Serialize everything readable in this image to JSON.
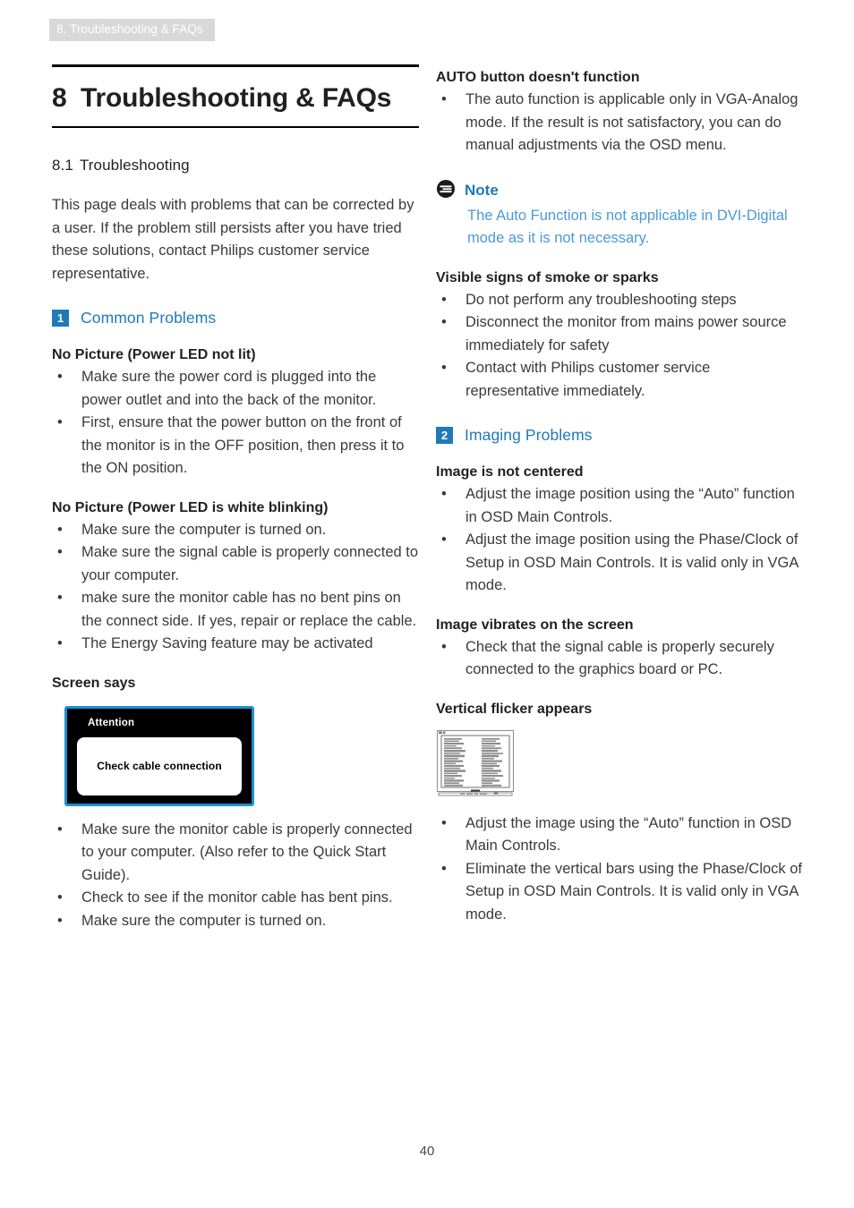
{
  "running_header": "8. Troubleshooting & FAQs",
  "chapter": {
    "number": "8",
    "title": "Troubleshooting & FAQs"
  },
  "section": {
    "number": "8.1",
    "title": "Troubleshooting"
  },
  "colors": {
    "accent_blue": "#1f7ab8",
    "note_body_blue": "#4a9ad4",
    "header_band_gray": "#d8d8d8",
    "osd_border_blue": "#1b8fd4"
  },
  "intro_paragraph": "This page deals with problems that can be corrected by a user. If the problem still persists after you have tried these solutions, contact Philips customer service representative.",
  "left_column": {
    "group_badge": "1",
    "group_title": "Common Problems",
    "blocks": [
      {
        "heading": "No Picture (Power LED not lit)",
        "bullets": [
          "Make sure the power cord is plugged into the power outlet and into the back of the monitor.",
          "First, ensure that the power button on the front of the monitor is in the OFF position, then press it to the ON position."
        ]
      },
      {
        "heading": "No Picture (Power LED is white blinking)",
        "bullets": [
          "Make sure the computer is turned on.",
          "Make sure the signal cable is properly connected to your computer.",
          "make sure the monitor cable has no bent pins on the connect side. If yes, repair or replace the cable.",
          "The Energy Saving feature may be activated"
        ]
      },
      {
        "heading": "Screen says",
        "figure": {
          "type": "osd-attention-dialog",
          "title": "Attention",
          "message": "Check cable connection"
        },
        "bullets": [
          "Make sure the monitor cable is properly connected to your computer. (Also refer to the Quick Start Guide).",
          "Check to see if the monitor cable has bent pins.",
          "Make sure the computer is turned on."
        ]
      }
    ]
  },
  "right_column": {
    "top_block": {
      "heading": "AUTO button doesn't function",
      "bullets": [
        "The auto function is applicable only in VGA-Analog mode.  If the result is not satisfactory, you can do manual adjustments via the OSD menu."
      ]
    },
    "note": {
      "icon": "note-icon",
      "title": "Note",
      "body": "The Auto Function is not applicable in DVI-Digital mode as it is not necessary."
    },
    "smoke_block": {
      "heading": "Visible signs of smoke or sparks",
      "bullets": [
        "Do not perform any troubleshooting steps",
        "Disconnect the monitor from mains power source immediately for safety",
        "Contact with Philips customer service representative immediately."
      ]
    },
    "group_badge": "2",
    "group_title": "Imaging Problems",
    "blocks": [
      {
        "heading": "Image is not centered",
        "bullets": [
          "Adjust the image position using the “Auto” function in OSD Main Controls.",
          "Adjust the image position using the Phase/Clock of Setup in OSD Main Controls.  It is valid only in VGA mode."
        ]
      },
      {
        "heading": "Image vibrates on the screen",
        "bullets": [
          "Check that the signal cable is properly securely connected to the graphics board or PC."
        ]
      },
      {
        "heading": "Vertical flicker appears",
        "figure": {
          "type": "vertical-flicker-illustration"
        },
        "bullets": [
          "Adjust the image using the “Auto” function in OSD Main Controls.",
          "Eliminate the vertical bars using the Phase/Clock of Setup in OSD Main Controls. It is valid only in VGA mode."
        ]
      }
    ]
  },
  "page_number": "40"
}
